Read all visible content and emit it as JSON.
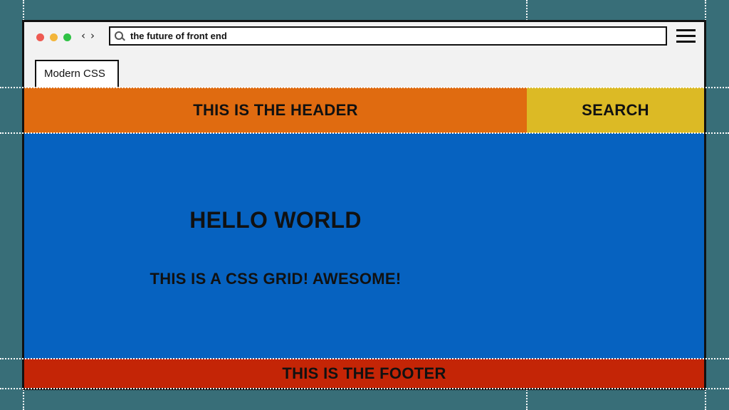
{
  "browser": {
    "url": "the future of front end",
    "tab_label": "Modern CSS",
    "nav_back": "‹",
    "nav_forward": "›",
    "traffic_lights": [
      "#ee5a52",
      "#f3b53a",
      "#2fc245"
    ]
  },
  "layout": {
    "header_text": "THIS IS THE HEADER",
    "search_text": "SEARCH",
    "main_title": "HELLO WORLD",
    "main_subtitle": "THIS IS A CSS GRID! AWESOME!",
    "footer_text": "THIS IS THE FOOTER"
  },
  "colors": {
    "background": "#386e78",
    "header": "#e06b10",
    "search": "#dcba25",
    "main": "#0662c0",
    "footer": "#c42506"
  },
  "icons": [
    "search-icon",
    "hamburger-menu-icon",
    "back-icon",
    "forward-icon"
  ]
}
